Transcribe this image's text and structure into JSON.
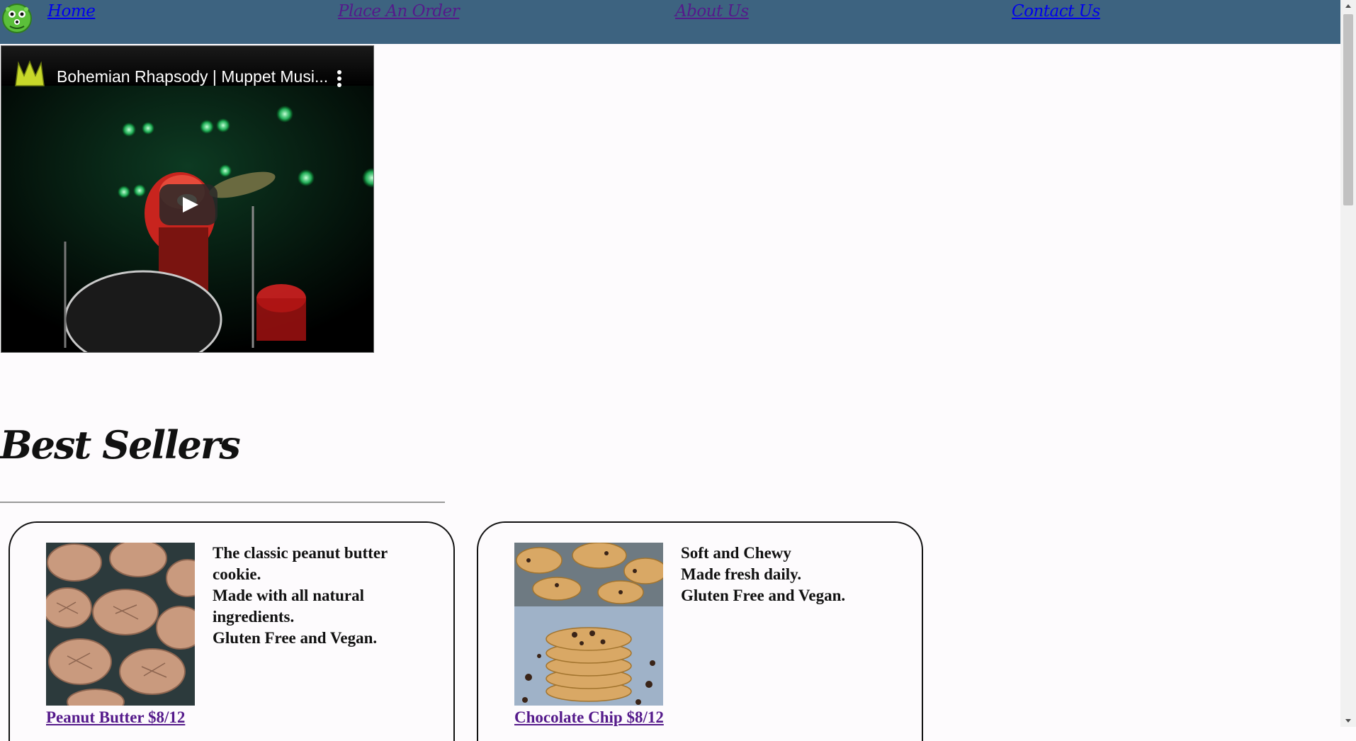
{
  "nav": {
    "home": "Home",
    "order": "Place An Order",
    "about": "About Us",
    "contact": "Contact Us"
  },
  "video": {
    "title": "Bohemian Rhapsody | Muppet Musi..."
  },
  "best_sellers": {
    "title": "Best Sellers",
    "products": [
      {
        "lines": [
          "The classic peanut butter cookie.",
          "Made with all natural ingredients.",
          "Gluten Free and Vegan."
        ],
        "link": "Peanut Butter $8/12"
      },
      {
        "lines": [
          "Soft and Chewy",
          "Made fresh daily.",
          "Gluten Free and Vegan."
        ],
        "link": "Chocolate Chip $8/12"
      }
    ]
  },
  "colors": {
    "nav_bg": "#3d6380",
    "visited_link": "#551a8b",
    "unvisited_link": "#0000ee",
    "page_bg": "#fdfbfd"
  },
  "icons": {
    "logo": "green-monster-logo-icon",
    "play": "play-icon",
    "more": "more-vert-icon",
    "channel": "muppets-channel-icon"
  }
}
